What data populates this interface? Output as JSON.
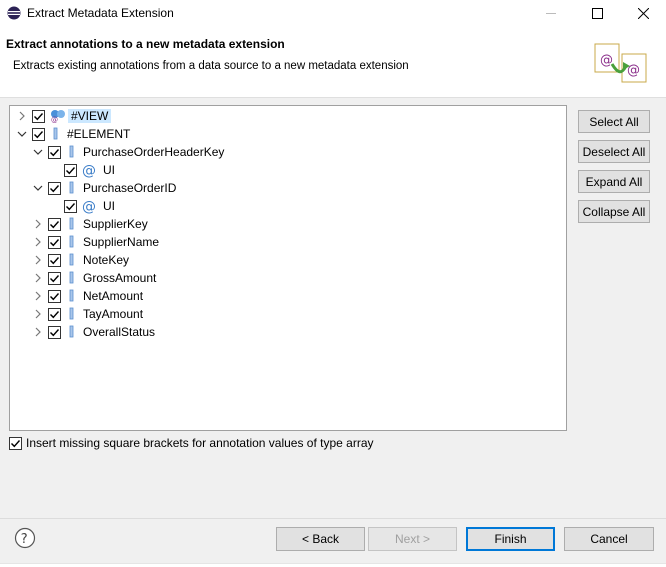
{
  "window": {
    "title": "Extract Metadata Extension",
    "controls": [
      "minimize",
      "maximize",
      "close"
    ]
  },
  "banner": {
    "title": "Extract annotations to a new metadata extension",
    "description": "Extracts existing annotations from a data source to a new metadata extension"
  },
  "tree": {
    "rows": [
      {
        "label": "#VIEW",
        "expanded": false,
        "checked": true,
        "icon": "view-annotation-icon",
        "selected": true
      },
      {
        "label": "#ELEMENT",
        "expanded": true,
        "checked": true,
        "icon": "element-icon"
      },
      {
        "label": "PurchaseOrderHeaderKey",
        "expanded": true,
        "checked": true,
        "icon": "element-icon"
      },
      {
        "label": "UI",
        "checked": true,
        "icon": "annotation-at-icon"
      },
      {
        "label": "PurchaseOrderID",
        "expanded": true,
        "checked": true,
        "icon": "element-icon"
      },
      {
        "label": "UI",
        "checked": true,
        "icon": "annotation-at-icon"
      },
      {
        "label": "SupplierKey",
        "expanded": false,
        "checked": true,
        "icon": "element-icon"
      },
      {
        "label": "SupplierName",
        "expanded": false,
        "checked": true,
        "icon": "element-icon"
      },
      {
        "label": "NoteKey",
        "expanded": false,
        "checked": true,
        "icon": "element-icon"
      },
      {
        "label": "GrossAmount",
        "expanded": false,
        "checked": true,
        "icon": "element-icon"
      },
      {
        "label": "NetAmount",
        "expanded": false,
        "checked": true,
        "icon": "element-icon"
      },
      {
        "label": "TayAmount",
        "expanded": false,
        "checked": true,
        "icon": "element-icon"
      },
      {
        "label": "OverallStatus",
        "expanded": false,
        "checked": true,
        "icon": "element-icon"
      }
    ]
  },
  "side_buttons": {
    "select_all": "Select All",
    "deselect_all": "Deselect All",
    "expand_all": "Expand All",
    "collapse_all": "Collapse All"
  },
  "option": {
    "label": "Insert missing square brackets for annotation values of type array",
    "checked": true
  },
  "footer": {
    "back": "< Back",
    "next": "Next >",
    "finish": "Finish",
    "cancel": "Cancel"
  },
  "colors": {
    "selection": "#cce8ff",
    "accent": "#0078d7",
    "element_icon": "#6b9bd2"
  }
}
